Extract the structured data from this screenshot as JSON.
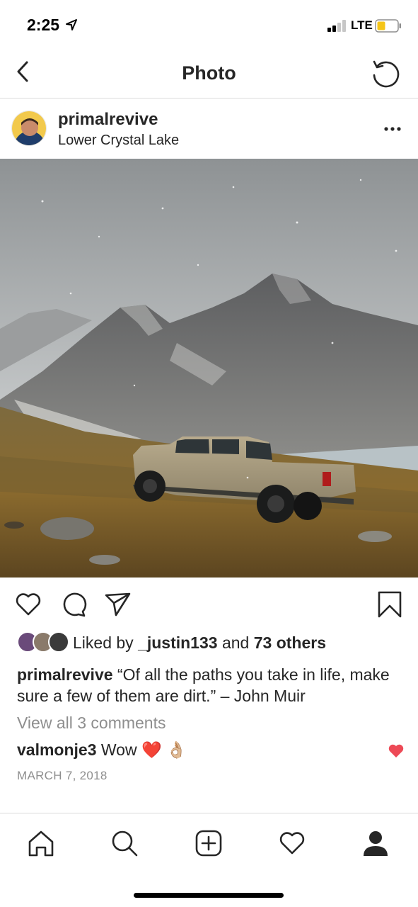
{
  "status_bar": {
    "time": "2:25",
    "network": "LTE",
    "battery_color": "#f5c518"
  },
  "nav": {
    "title": "Photo",
    "back_icon": "chevron-left-icon",
    "refresh_icon": "refresh-icon"
  },
  "post": {
    "username": "primalrevive",
    "location": "Lower Crystal Lake",
    "photo_description": "Tan pickup truck on grassy alpine meadow below snowy mountains",
    "liked_by_user": "_justin133",
    "liked_by_prefix": "Liked by",
    "liked_by_and": "and",
    "liked_by_others": "73 others",
    "caption_user": "primalrevive",
    "caption_text": "“Of all the paths you take in life, make sure a few of them are dirt.” – John Muir",
    "view_comments": "View all 3 comments",
    "comment_user": "valmonje3",
    "comment_text": "Wow ❤️ 👌🏼",
    "date": "MARCH 7, 2018"
  },
  "actions": [
    "like-icon",
    "comment-icon",
    "share-icon",
    "save-icon"
  ],
  "tabbar": [
    "home-icon",
    "search-icon",
    "add-icon",
    "activity-icon",
    "profile-icon"
  ],
  "colors": {
    "text": "#262626",
    "muted": "#8e8e8e",
    "divider": "#dbdbdb",
    "heart_red": "#ed4956"
  }
}
